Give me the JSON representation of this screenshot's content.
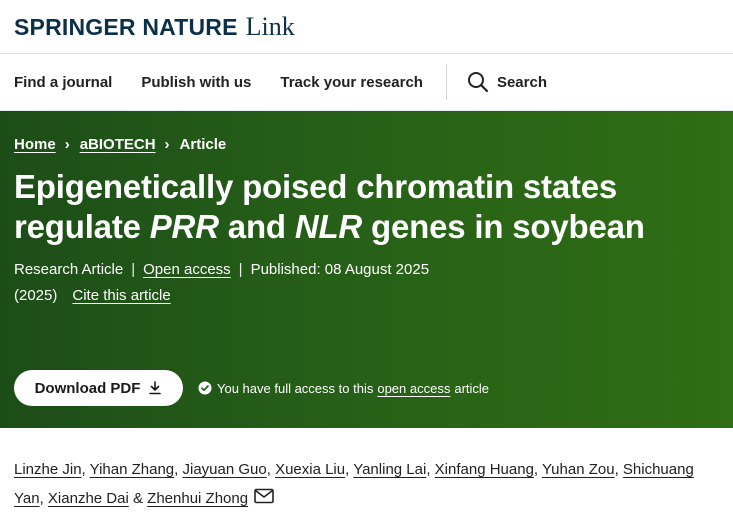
{
  "header": {
    "brand": "SPRINGER NATURE",
    "brand_sub": "Link"
  },
  "nav": {
    "items": [
      "Find a journal",
      "Publish with us",
      "Track your research"
    ],
    "search_label": "Search"
  },
  "breadcrumb": [
    "Home",
    "aBIOTECH",
    "Article"
  ],
  "article": {
    "title_part1": "Epigenetically poised chromatin states regulate ",
    "title_em1": "PRR",
    "title_part2": " and ",
    "title_em2": "NLR",
    "title_part3": " genes in soybean",
    "type": "Research Article",
    "open_access": "Open access",
    "published": "Published: 08 August 2025",
    "year": "(2025)",
    "cite": "Cite this article"
  },
  "actions": {
    "download_pdf": "Download PDF",
    "access_prefix": "You have full access to this",
    "access_link": "open access",
    "access_suffix": "article"
  },
  "authors": {
    "list": [
      "Linzhe Jin",
      "Yihan Zhang",
      "Jiayuan Guo",
      "Xuexia Liu",
      "Yanling Lai",
      "Xinfang Huang",
      "Yuhan Zou",
      "Shichuang Yan",
      "Xianzhe Dai"
    ],
    "last": "Zhenhui Zhong",
    "sep": ",",
    "and": "&"
  },
  "colors": {
    "brand_navy": "#0c2f4a",
    "hero_green": "#265f18"
  }
}
